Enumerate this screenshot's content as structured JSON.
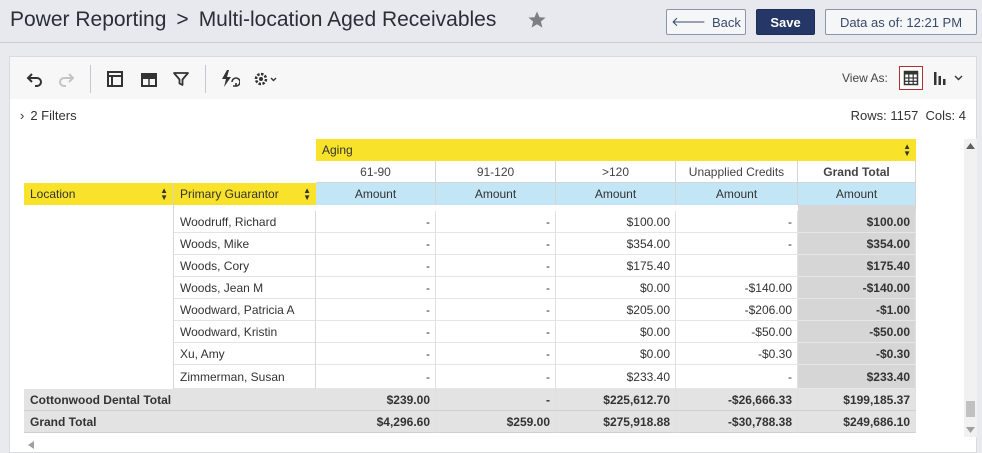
{
  "header": {
    "breadcrumb_root": "Power Reporting",
    "separator": ">",
    "page_title": "Multi-location Aged Receivables",
    "back_label": "Back",
    "save_label": "Save",
    "data_as_of": "Data as of: 12:21 PM"
  },
  "toolbar": {
    "icons": [
      "undo-icon",
      "redo-icon",
      "layout-icon",
      "table-icon",
      "filter-icon",
      "refresh-icon",
      "settings-icon"
    ],
    "view_as_label": "View As:"
  },
  "filters": {
    "label": "2 Filters"
  },
  "stats": {
    "rows": "Rows: 1157",
    "cols": "Cols: 4"
  },
  "table": {
    "column_group": "Aging",
    "row_headers": [
      "Location",
      "Primary Guarantor"
    ],
    "columns": [
      "61-90",
      "91-120",
      ">120",
      "Unapplied Credits",
      "Grand Total"
    ],
    "measure": "Amount",
    "rows": [
      {
        "name": "Woodruff, Richard",
        "values": [
          "-",
          "-",
          "$100.00",
          "-",
          "$100.00"
        ]
      },
      {
        "name": "Woods, Mike",
        "values": [
          "-",
          "-",
          "$354.00",
          "-",
          "$354.00"
        ]
      },
      {
        "name": "Woods, Cory",
        "values": [
          "-",
          "-",
          "$175.40",
          "",
          "$175.40"
        ]
      },
      {
        "name": "Woods, Jean M",
        "values": [
          "-",
          "-",
          "$0.00",
          "-$140.00",
          "-$140.00"
        ]
      },
      {
        "name": "Woodward, Patricia A",
        "values": [
          "-",
          "-",
          "$205.00",
          "-$206.00",
          "-$1.00"
        ]
      },
      {
        "name": "Woodward, Kristin",
        "values": [
          "-",
          "-",
          "$0.00",
          "-$50.00",
          "-$50.00"
        ]
      },
      {
        "name": "Xu, Amy",
        "values": [
          "-",
          "-",
          "$0.00",
          "-$0.30",
          "-$0.30"
        ]
      },
      {
        "name": "Zimmerman, Susan",
        "values": [
          "-",
          "-",
          "$233.40",
          "-",
          "$233.40"
        ]
      }
    ],
    "subtotal": {
      "name": "Cottonwood Dental Total",
      "values": [
        "$239.00",
        "-",
        "$225,612.70",
        "-$26,666.33",
        "$199,185.37"
      ]
    },
    "grand_total": {
      "name": "Grand Total",
      "values": [
        "$4,296.60",
        "$259.00",
        "$275,918.88",
        "-$30,788.38",
        "$249,686.10"
      ]
    }
  }
}
